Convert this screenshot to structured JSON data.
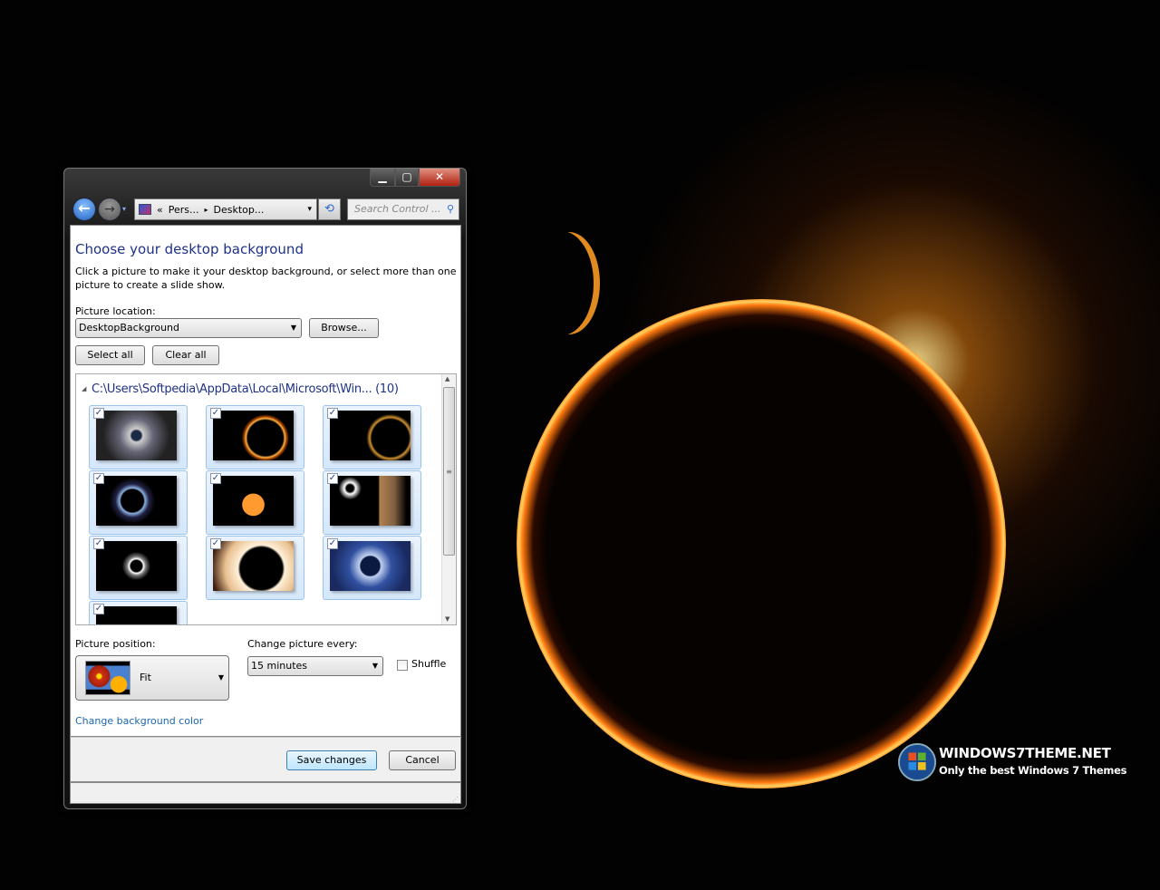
{
  "window": {
    "caption_buttons": {
      "minimize": "▁",
      "maximize": "▢",
      "close": "✕"
    },
    "nav": {
      "back_icon": "arrow-left-icon",
      "forward_icon": "arrow-right-icon",
      "back": "←",
      "forward": "→",
      "history": "▾"
    },
    "address": {
      "icon": "control-panel-icon",
      "overflow": "«",
      "crumbs": [
        "Pers...",
        "Desktop..."
      ],
      "separator": "▸",
      "dropdown": "▾"
    },
    "refresh": "⟲",
    "search": {
      "placeholder": "Search Control ...",
      "icon": "⚲"
    }
  },
  "content": {
    "title": "Choose your desktop background",
    "description_line1": "Click a picture to make it your desktop background, or select more than one",
    "description_line2": "picture to create a slide show.",
    "location_label": "Picture location:",
    "location_value": "DesktopBackground",
    "browse": "Browse...",
    "select_all": "Select all",
    "clear_all": "Clear all",
    "group_header": "C:\\Users\\Softpedia\\AppData\\Local\\Microsoft\\Win... (10)",
    "group_toggle": "◢",
    "pictures": [
      {
        "checked": true
      },
      {
        "checked": true
      },
      {
        "checked": true
      },
      {
        "checked": true
      },
      {
        "checked": true
      },
      {
        "checked": true
      },
      {
        "checked": true
      },
      {
        "checked": true
      },
      {
        "checked": true
      },
      {
        "checked": true
      }
    ],
    "position_label": "Picture position:",
    "position_value": "Fit",
    "interval_label": "Change picture every:",
    "interval_value": "15 minutes",
    "shuffle_label": "Shuffle",
    "shuffle_checked": false,
    "change_color_link": "Change background color"
  },
  "footer": {
    "save": "Save changes",
    "cancel": "Cancel"
  },
  "desktop": {
    "brand_line1": "WINDOWS7THEME.NET",
    "brand_line2": "Only the best Windows 7 Themes"
  },
  "colors": {
    "title": "#1e3287",
    "link": "#1a66b0",
    "selection": "#d5e7fb"
  }
}
